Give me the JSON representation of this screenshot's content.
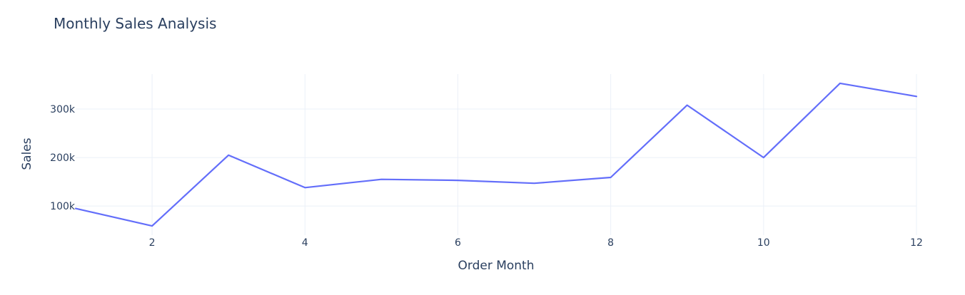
{
  "chart_data": {
    "type": "line",
    "title": "Monthly Sales Analysis",
    "xlabel": "Order Month",
    "ylabel": "Sales",
    "xlim": [
      1,
      12
    ],
    "ylim": [
      40000,
      372000
    ],
    "x_ticks": [
      2,
      4,
      6,
      8,
      10,
      12
    ],
    "y_ticks": [
      100000,
      200000,
      300000
    ],
    "y_tick_labels": [
      "100k",
      "200k",
      "300k"
    ],
    "grid": true,
    "series": [
      {
        "line_color": "#636efa",
        "x": [
          1,
          2,
          3,
          4,
          5,
          6,
          7,
          8,
          9,
          10,
          11,
          12
        ],
        "y": [
          95000,
          59000,
          205000,
          138000,
          155000,
          153000,
          147000,
          159000,
          308000,
          200000,
          353000,
          326000
        ]
      }
    ]
  }
}
